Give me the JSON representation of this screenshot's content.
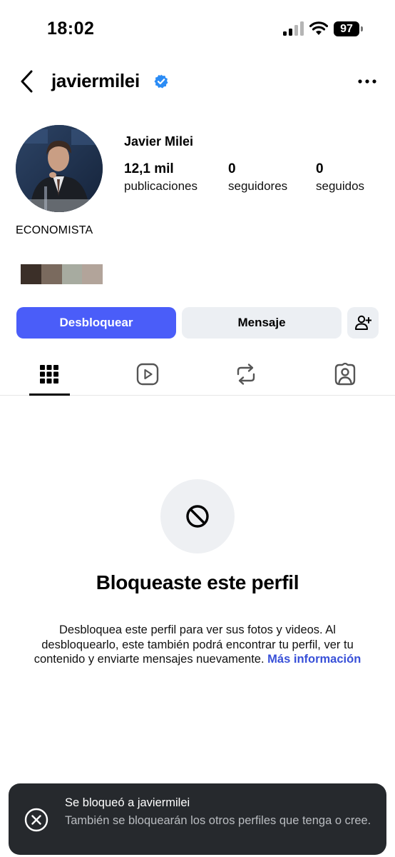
{
  "status_bar": {
    "time": "18:02",
    "battery": "97"
  },
  "header": {
    "username": "javiermilei",
    "verified_icon": "verified-badge-icon",
    "more_icon": "ellipsis-icon",
    "back_icon": "chevron-left-icon"
  },
  "profile": {
    "name": "Javier Milei",
    "stats": [
      {
        "value": "12,1 mil",
        "label": "publicaciones"
      },
      {
        "value": "0",
        "label": "seguidores"
      },
      {
        "value": "0",
        "label": "seguidos"
      }
    ],
    "bio": "ECONOMISTA"
  },
  "actions": {
    "unblock_label": "Desbloquear",
    "message_label": "Mensaje",
    "add_icon": "add-person-icon"
  },
  "tabs": [
    {
      "icon": "grid-icon",
      "active": true
    },
    {
      "icon": "reels-icon",
      "active": false
    },
    {
      "icon": "repost-icon",
      "active": false
    },
    {
      "icon": "tagged-icon",
      "active": false
    }
  ],
  "blocked": {
    "icon": "block-icon",
    "title": "Bloqueaste este perfil",
    "description": "Desbloquea este perfil para ver sus fotos y videos. Al desbloquearlo, este también podrá encontrar tu perfil, ver tu contenido y enviarte mensajes nuevamente.",
    "link": "Más información"
  },
  "toast": {
    "icon": "close-circle-icon",
    "title": "Se bloqueó a javiermilei",
    "body": "También se bloquearán los otros perfiles que tenga o cree."
  },
  "colors": {
    "accent": "#4a5df9",
    "verified": "#2b8cf5",
    "link": "#3850d8",
    "toast_bg": "#26292d"
  }
}
